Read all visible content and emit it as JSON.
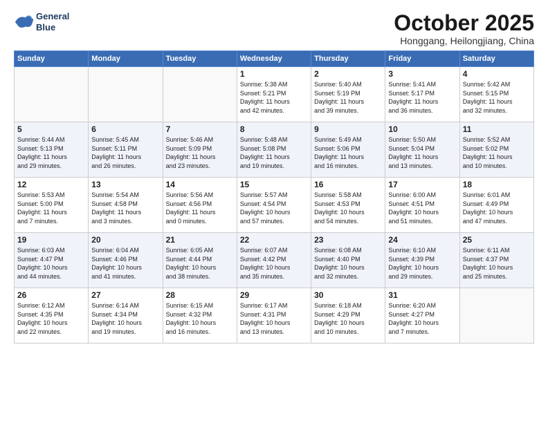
{
  "header": {
    "logo_line1": "General",
    "logo_line2": "Blue",
    "month": "October 2025",
    "location": "Honggang, Heilongjiang, China"
  },
  "weekdays": [
    "Sunday",
    "Monday",
    "Tuesday",
    "Wednesday",
    "Thursday",
    "Friday",
    "Saturday"
  ],
  "weeks": [
    [
      {
        "day": "",
        "text": ""
      },
      {
        "day": "",
        "text": ""
      },
      {
        "day": "",
        "text": ""
      },
      {
        "day": "1",
        "text": "Sunrise: 5:38 AM\nSunset: 5:21 PM\nDaylight: 11 hours\nand 42 minutes."
      },
      {
        "day": "2",
        "text": "Sunrise: 5:40 AM\nSunset: 5:19 PM\nDaylight: 11 hours\nand 39 minutes."
      },
      {
        "day": "3",
        "text": "Sunrise: 5:41 AM\nSunset: 5:17 PM\nDaylight: 11 hours\nand 36 minutes."
      },
      {
        "day": "4",
        "text": "Sunrise: 5:42 AM\nSunset: 5:15 PM\nDaylight: 11 hours\nand 32 minutes."
      }
    ],
    [
      {
        "day": "5",
        "text": "Sunrise: 5:44 AM\nSunset: 5:13 PM\nDaylight: 11 hours\nand 29 minutes."
      },
      {
        "day": "6",
        "text": "Sunrise: 5:45 AM\nSunset: 5:11 PM\nDaylight: 11 hours\nand 26 minutes."
      },
      {
        "day": "7",
        "text": "Sunrise: 5:46 AM\nSunset: 5:09 PM\nDaylight: 11 hours\nand 23 minutes."
      },
      {
        "day": "8",
        "text": "Sunrise: 5:48 AM\nSunset: 5:08 PM\nDaylight: 11 hours\nand 19 minutes."
      },
      {
        "day": "9",
        "text": "Sunrise: 5:49 AM\nSunset: 5:06 PM\nDaylight: 11 hours\nand 16 minutes."
      },
      {
        "day": "10",
        "text": "Sunrise: 5:50 AM\nSunset: 5:04 PM\nDaylight: 11 hours\nand 13 minutes."
      },
      {
        "day": "11",
        "text": "Sunrise: 5:52 AM\nSunset: 5:02 PM\nDaylight: 11 hours\nand 10 minutes."
      }
    ],
    [
      {
        "day": "12",
        "text": "Sunrise: 5:53 AM\nSunset: 5:00 PM\nDaylight: 11 hours\nand 7 minutes."
      },
      {
        "day": "13",
        "text": "Sunrise: 5:54 AM\nSunset: 4:58 PM\nDaylight: 11 hours\nand 3 minutes."
      },
      {
        "day": "14",
        "text": "Sunrise: 5:56 AM\nSunset: 4:56 PM\nDaylight: 11 hours\nand 0 minutes."
      },
      {
        "day": "15",
        "text": "Sunrise: 5:57 AM\nSunset: 4:54 PM\nDaylight: 10 hours\nand 57 minutes."
      },
      {
        "day": "16",
        "text": "Sunrise: 5:58 AM\nSunset: 4:53 PM\nDaylight: 10 hours\nand 54 minutes."
      },
      {
        "day": "17",
        "text": "Sunrise: 6:00 AM\nSunset: 4:51 PM\nDaylight: 10 hours\nand 51 minutes."
      },
      {
        "day": "18",
        "text": "Sunrise: 6:01 AM\nSunset: 4:49 PM\nDaylight: 10 hours\nand 47 minutes."
      }
    ],
    [
      {
        "day": "19",
        "text": "Sunrise: 6:03 AM\nSunset: 4:47 PM\nDaylight: 10 hours\nand 44 minutes."
      },
      {
        "day": "20",
        "text": "Sunrise: 6:04 AM\nSunset: 4:46 PM\nDaylight: 10 hours\nand 41 minutes."
      },
      {
        "day": "21",
        "text": "Sunrise: 6:05 AM\nSunset: 4:44 PM\nDaylight: 10 hours\nand 38 minutes."
      },
      {
        "day": "22",
        "text": "Sunrise: 6:07 AM\nSunset: 4:42 PM\nDaylight: 10 hours\nand 35 minutes."
      },
      {
        "day": "23",
        "text": "Sunrise: 6:08 AM\nSunset: 4:40 PM\nDaylight: 10 hours\nand 32 minutes."
      },
      {
        "day": "24",
        "text": "Sunrise: 6:10 AM\nSunset: 4:39 PM\nDaylight: 10 hours\nand 29 minutes."
      },
      {
        "day": "25",
        "text": "Sunrise: 6:11 AM\nSunset: 4:37 PM\nDaylight: 10 hours\nand 25 minutes."
      }
    ],
    [
      {
        "day": "26",
        "text": "Sunrise: 6:12 AM\nSunset: 4:35 PM\nDaylight: 10 hours\nand 22 minutes."
      },
      {
        "day": "27",
        "text": "Sunrise: 6:14 AM\nSunset: 4:34 PM\nDaylight: 10 hours\nand 19 minutes."
      },
      {
        "day": "28",
        "text": "Sunrise: 6:15 AM\nSunset: 4:32 PM\nDaylight: 10 hours\nand 16 minutes."
      },
      {
        "day": "29",
        "text": "Sunrise: 6:17 AM\nSunset: 4:31 PM\nDaylight: 10 hours\nand 13 minutes."
      },
      {
        "day": "30",
        "text": "Sunrise: 6:18 AM\nSunset: 4:29 PM\nDaylight: 10 hours\nand 10 minutes."
      },
      {
        "day": "31",
        "text": "Sunrise: 6:20 AM\nSunset: 4:27 PM\nDaylight: 10 hours\nand 7 minutes."
      },
      {
        "day": "",
        "text": ""
      }
    ]
  ]
}
